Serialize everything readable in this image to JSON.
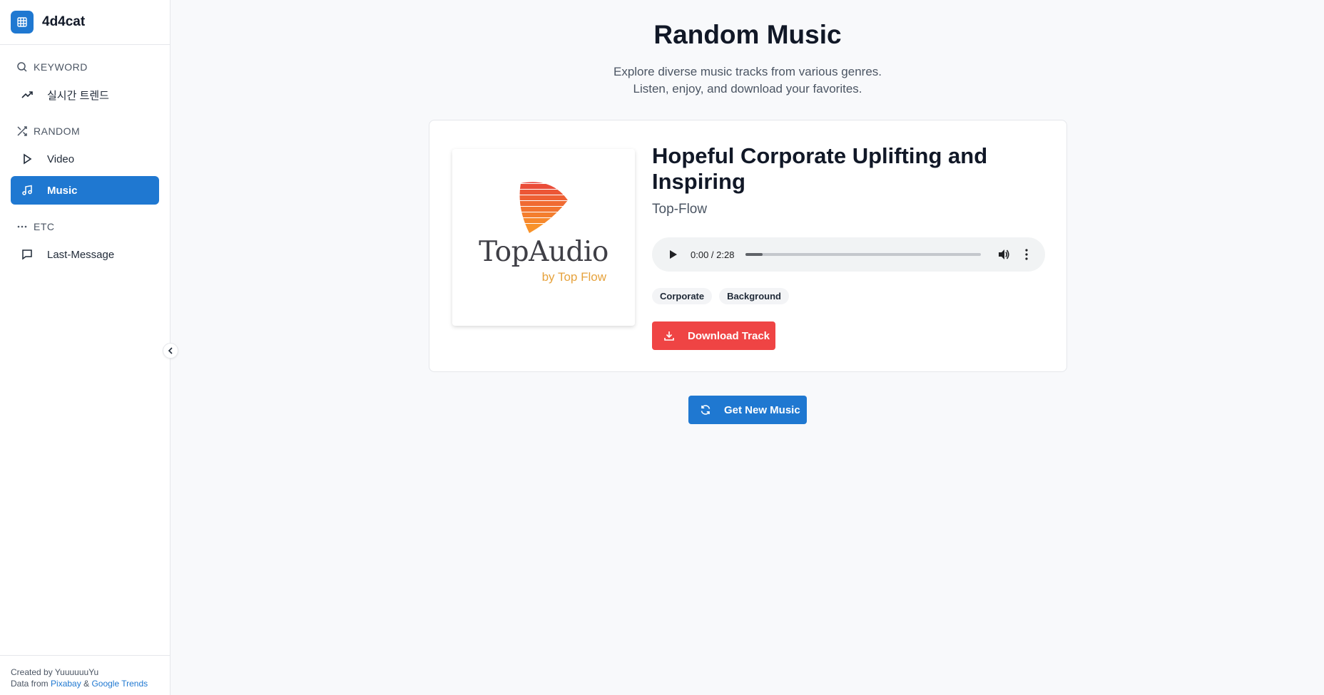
{
  "brand": {
    "name": "4d4cat",
    "icon": "grid-icon"
  },
  "sidebar": {
    "sections": [
      {
        "label": "KEYWORD",
        "icon": "search-icon",
        "items": [
          {
            "label": "실시간 트렌드",
            "icon": "trending-icon"
          }
        ]
      },
      {
        "label": "RANDOM",
        "icon": "shuffle-icon",
        "items": [
          {
            "label": "Video",
            "icon": "play-icon"
          },
          {
            "label": "Music",
            "icon": "music-note-icon",
            "active": true
          }
        ]
      },
      {
        "label": "ETC",
        "icon": "ellipsis-icon",
        "items": [
          {
            "label": "Last-Message",
            "icon": "message-icon"
          }
        ]
      }
    ],
    "footer": {
      "created": "Created by YuuuuuuYu",
      "data_from": "Data from",
      "source1": "Pixabay",
      "amp": "&",
      "source2": "Google Trends"
    }
  },
  "main": {
    "title": "Random Music",
    "subtitle_line1": "Explore diverse music tracks from various genres.",
    "subtitle_line2": "Listen, enjoy, and download your favorites."
  },
  "track": {
    "title": "Hopeful Corporate Uplifting and Inspiring",
    "artist": "Top-Flow",
    "art_logo": "TopAudio",
    "art_sub": "by Top Flow",
    "tags": [
      "Corporate",
      "Background"
    ],
    "download_label": "Download Track"
  },
  "player": {
    "time": "0:00 / 2:28",
    "progress": 0.07
  },
  "actions": {
    "new_music_label": "Get New Music"
  },
  "colors": {
    "accent": "#1f78d1",
    "danger": "#ef4444",
    "sidebar_bg": "#ffffff",
    "page_bg": "#f8f9fb"
  }
}
